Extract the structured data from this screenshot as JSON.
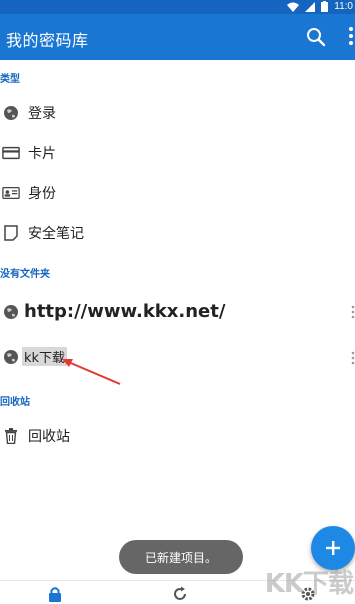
{
  "status": {
    "time": "11:0"
  },
  "app": {
    "title": "我的密码库"
  },
  "sections": {
    "types": "类型",
    "no_folder": "没有文件夹",
    "trash": "回收站"
  },
  "types": [
    {
      "label": "登录",
      "icon": "globe-icon"
    },
    {
      "label": "卡片",
      "icon": "card-icon"
    },
    {
      "label": "身份",
      "icon": "id-card-icon"
    },
    {
      "label": "安全笔记",
      "icon": "note-icon"
    }
  ],
  "vault_items": [
    {
      "label": "http://www.kkx.net/",
      "icon": "globe-icon"
    },
    {
      "label": "kk下载",
      "icon": "globe-icon"
    }
  ],
  "trash_item": {
    "label": "回收站",
    "icon": "trash-icon"
  },
  "toast": "已新建项目。",
  "watermark": "KK下载",
  "colors": {
    "appbar": "#1976d2",
    "accent": "#1565c0",
    "fab": "#1e88e5"
  }
}
